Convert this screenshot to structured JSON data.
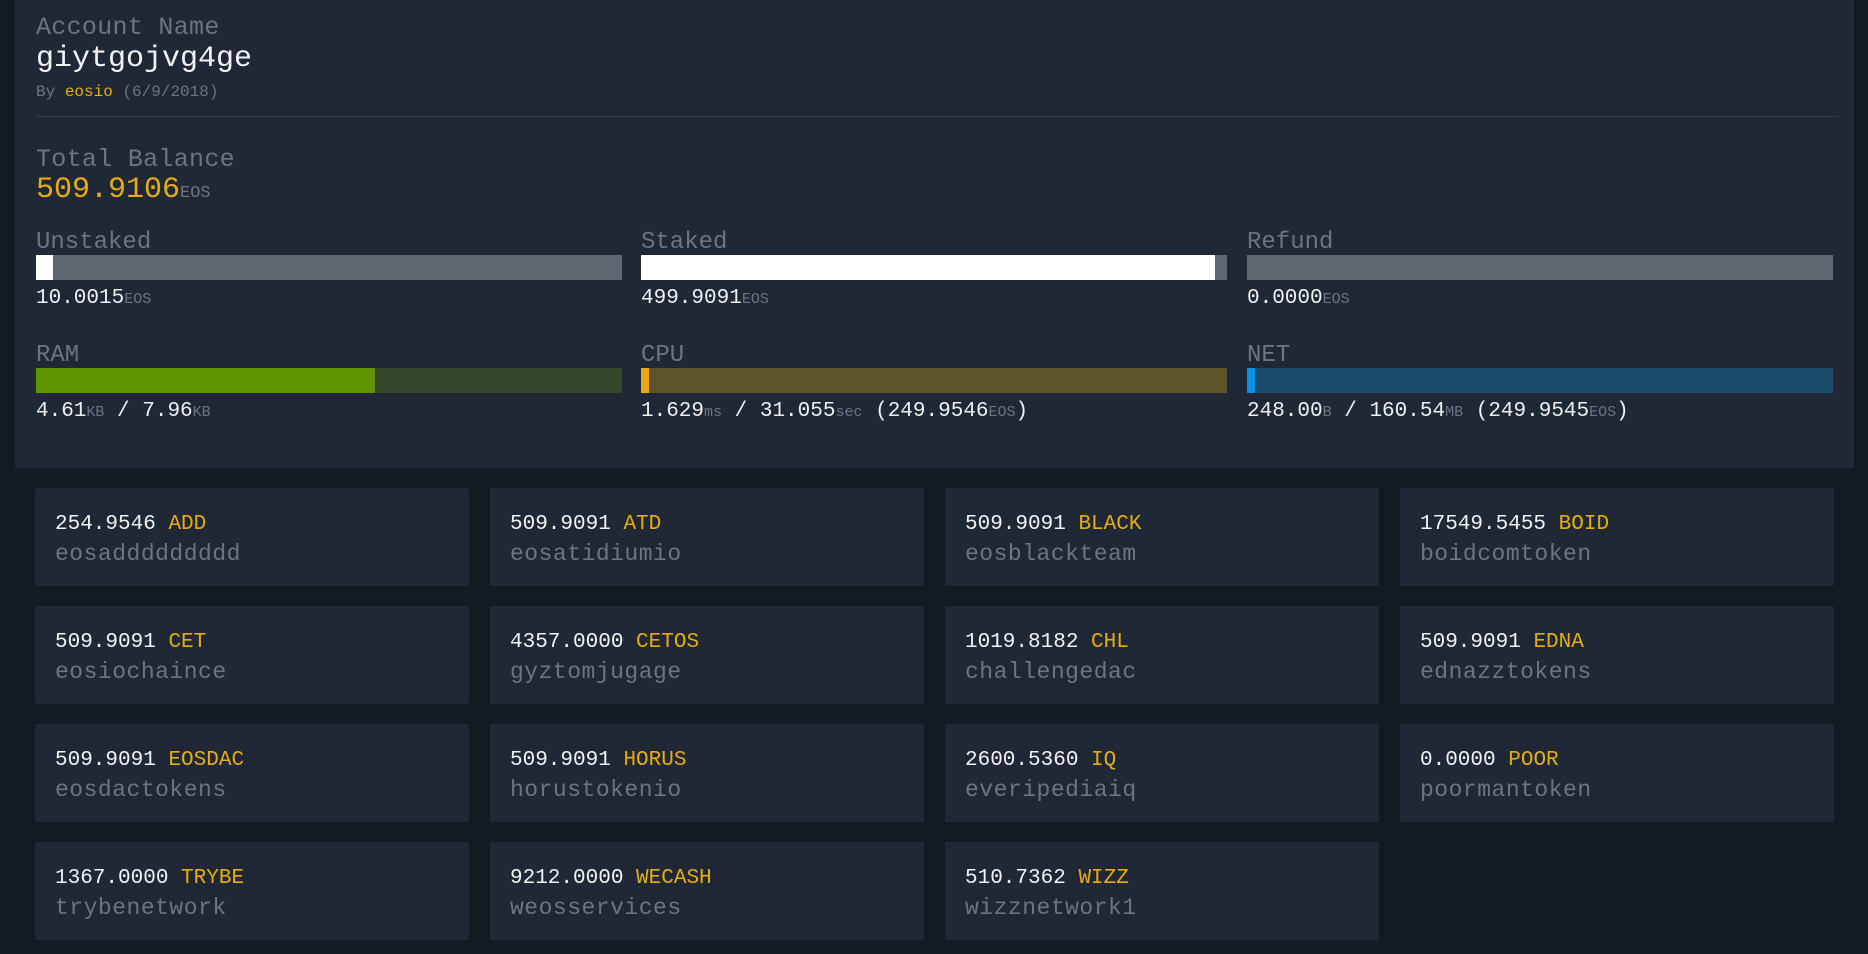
{
  "account": {
    "label": "Account Name",
    "name": "giytgojvg4ge",
    "by_prefix": "By",
    "creator": "eosio",
    "created": "(6/9/2018)"
  },
  "balance": {
    "label": "Total Balance",
    "value": "509.9106",
    "unit": "EOS"
  },
  "resources": [
    {
      "label": "Unstaked",
      "value": "10.0015",
      "unit": "EOS",
      "fill_pct": 2.9,
      "color": "#ffffff",
      "track": "#5f6670"
    },
    {
      "label": "Staked",
      "value": "499.9091",
      "unit": "EOS",
      "fill_pct": 98.0,
      "color": "#ffffff",
      "track": "#5f6670"
    },
    {
      "label": "Refund",
      "value": "0.0000",
      "unit": "EOS",
      "fill_pct": 0,
      "color": "#ffffff",
      "track": "#5f6670"
    },
    {
      "label": "RAM",
      "used": "4.61",
      "used_unit": "KB",
      "total": "7.96",
      "total_unit": "KB",
      "fill_pct": 57.9,
      "color": "#5f9300",
      "track": "#33482a"
    },
    {
      "label": "CPU",
      "used": "1.629",
      "used_unit": "ms",
      "total": "31.055",
      "total_unit": "sec",
      "staked": "249.9546",
      "staked_unit": "EOS",
      "fill_pct": 1,
      "color": "#e8a90e",
      "track": "#5d5429"
    },
    {
      "label": "NET",
      "used": "248.00",
      "used_unit": "B",
      "total": "160.54",
      "total_unit": "MB",
      "staked": "249.9545",
      "staked_unit": "EOS",
      "fill_pct": 1,
      "color": "#0b92e8",
      "track": "#1a4a6a"
    }
  ],
  "tokens": [
    {
      "amount": "254.9546",
      "symbol": "ADD",
      "contract": "eosaddddddddd"
    },
    {
      "amount": "509.9091",
      "symbol": "ATD",
      "contract": "eosatidiumio"
    },
    {
      "amount": "509.9091",
      "symbol": "BLACK",
      "contract": "eosblackteam"
    },
    {
      "amount": "17549.5455",
      "symbol": "BOID",
      "contract": "boidcomtoken"
    },
    {
      "amount": "509.9091",
      "symbol": "CET",
      "contract": "eosiochaince"
    },
    {
      "amount": "4357.0000",
      "symbol": "CETOS",
      "contract": "gyztomjugage"
    },
    {
      "amount": "1019.8182",
      "symbol": "CHL",
      "contract": "challengedac"
    },
    {
      "amount": "509.9091",
      "symbol": "EDNA",
      "contract": "ednazztokens"
    },
    {
      "amount": "509.9091",
      "symbol": "EOSDAC",
      "contract": "eosdactokens"
    },
    {
      "amount": "509.9091",
      "symbol": "HORUS",
      "contract": "horustokenio"
    },
    {
      "amount": "2600.5360",
      "symbol": "IQ",
      "contract": "everipediaiq"
    },
    {
      "amount": "0.0000",
      "symbol": "POOR",
      "contract": "poormantoken"
    },
    {
      "amount": "1367.0000",
      "symbol": "TRYBE",
      "contract": "trybenetwork"
    },
    {
      "amount": "9212.0000",
      "symbol": "WECASH",
      "contract": "weosservices"
    },
    {
      "amount": "510.7362",
      "symbol": "WIZZ",
      "contract": "wizznetwork1"
    }
  ]
}
